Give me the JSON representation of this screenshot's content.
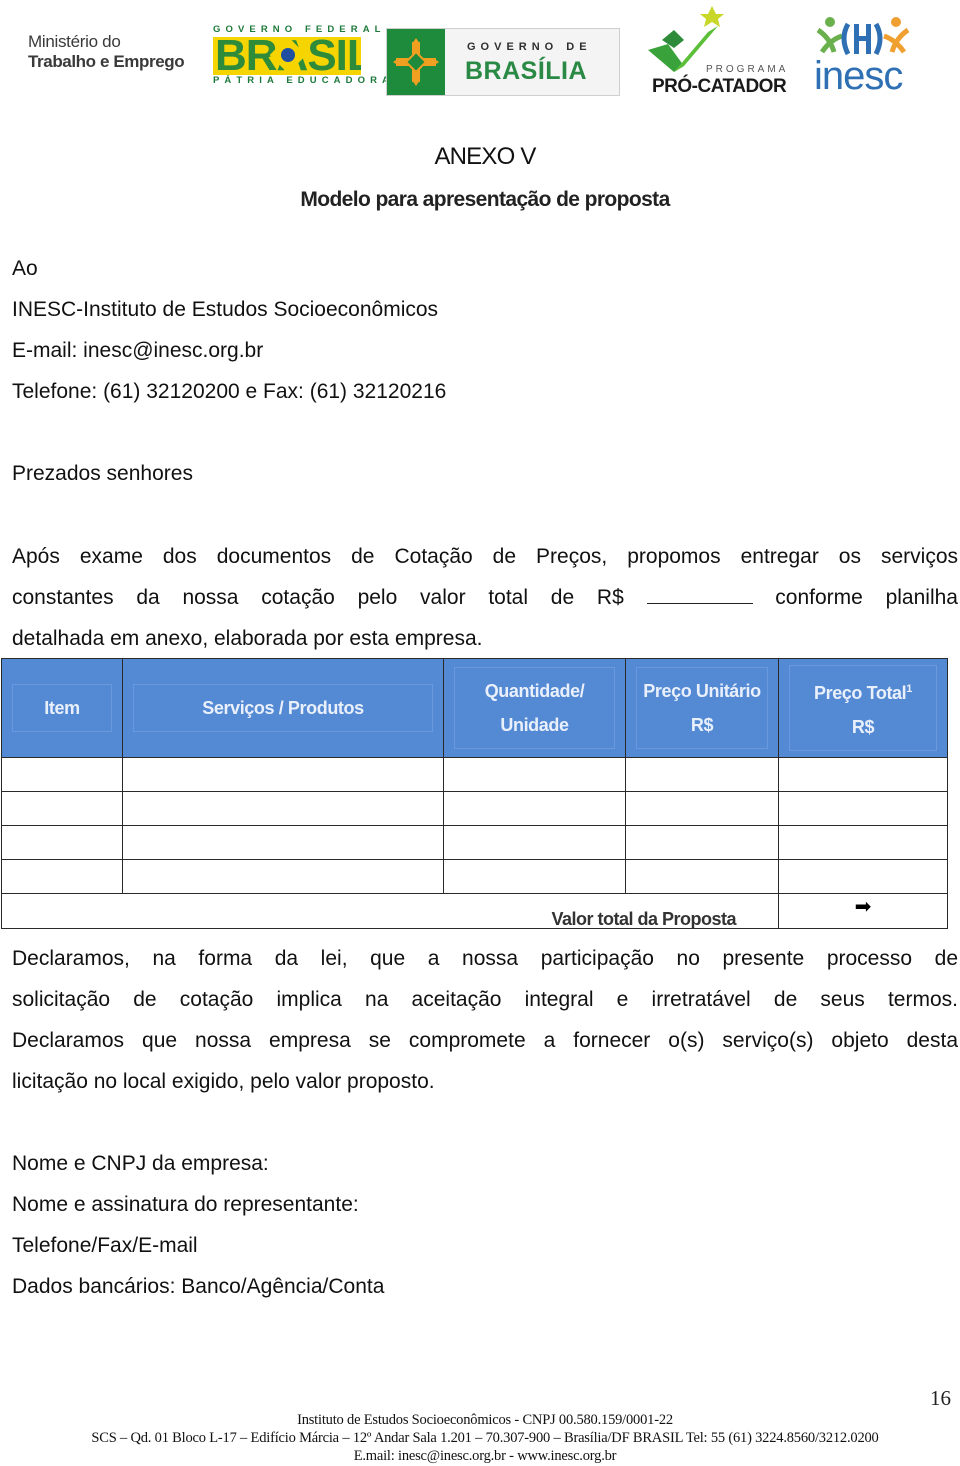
{
  "header": {
    "logos": {
      "ministerio": {
        "line1": "Ministério do",
        "line2": "Trabalho e Emprego"
      },
      "governo_federal": {
        "top": "GOVERNO FEDERAL",
        "brand": "BRASIL",
        "bottom": "PÁTRIA EDUCADORA",
        "colors": {
          "yellow": "#f5d400",
          "green": "#2e8b3a",
          "blue": "#1f4fa0"
        }
      },
      "governo_brasilia": {
        "line1": "GOVERNO DE",
        "line2": "BRASÍLIA",
        "colors": {
          "green": "#1e8a3c",
          "orange": "#f0a020"
        }
      },
      "pro_catador": {
        "line1": "PROGRAMA",
        "line2": "PRÓ-CATADOR",
        "colors": {
          "green": "#3aa23a",
          "star": "#c8d82a"
        }
      },
      "inesc": {
        "name": "inesc",
        "colors": {
          "blue": "#2f6fb3",
          "green": "#6ab04c",
          "orange": "#f0a030"
        }
      }
    }
  },
  "document": {
    "title": "ANEXO V",
    "subtitle": "Modelo para apresentação de proposta",
    "recipient": {
      "salutation_to": "Ao",
      "organization": "INESC-Instituto de Estudos Socioeconômicos",
      "email": "E-mail: inesc@inesc.org.br",
      "phone": "Telefone: (61) 32120200 e Fax: (61) 32120216"
    },
    "greeting": "Prezados senhores",
    "intro": {
      "line1": "Após exame dos documentos de Cotação de Preços, propomos entregar os serviços",
      "line2_before": "constantes da nossa cotação pelo valor total de R$",
      "line2_blank": "",
      "line2_after": "conforme planilha",
      "line3": "detalhada em anexo, elaborada por esta empresa."
    },
    "table": {
      "headers": [
        {
          "line1": "Item",
          "line2": ""
        },
        {
          "line1": "Serviços / Produtos",
          "line2": ""
        },
        {
          "line1": "Quantidade/",
          "line2": "Unidade"
        },
        {
          "line1": "Preço Unitário",
          "line2": "R$"
        },
        {
          "line1": "Preço Total",
          "footnote": "1",
          "line2": "R$"
        }
      ],
      "rows": [
        [
          "",
          "",
          "",
          "",
          ""
        ],
        [
          "",
          "",
          "",
          "",
          ""
        ],
        [
          "",
          "",
          "",
          "",
          ""
        ],
        [
          "",
          "",
          "",
          "",
          ""
        ]
      ],
      "total_label": "Valor total da Proposta",
      "total_value_icon": "arrow-right-icon",
      "total_value_glyph": "➡",
      "header_color": "#5489d3"
    },
    "declaration": {
      "line1": "Declaramos, na forma da lei, que a nossa participação no presente processo de",
      "line2": "solicitação de cotação implica na aceitação integral e irretratável de seus termos.",
      "line3": "Declaramos que nossa empresa se compromete a fornecer o(s) serviço(s) objeto desta",
      "line4": "licitação no local exigido, pelo valor proposto."
    },
    "fields": [
      "Nome e CNPJ da empresa:",
      "Nome e assinatura do representante:",
      "Telefone/Fax/E-mail",
      "Dados bancários: Banco/Agência/Conta"
    ]
  },
  "footer": {
    "page_number": "16",
    "line1": "Instituto de Estudos Socioeconômicos - CNPJ 00.580.159/0001-22",
    "line2": "SCS – Qd. 01 Bloco L-17 – Edifício Márcia – 12º Andar Sala 1.201 – 70.307-900 – Brasília/DF BRASIL Tel: 55 (61) 3224.8560/3212.0200",
    "line3": "E.mail: inesc@inesc.org.br - www.inesc.org.br"
  }
}
